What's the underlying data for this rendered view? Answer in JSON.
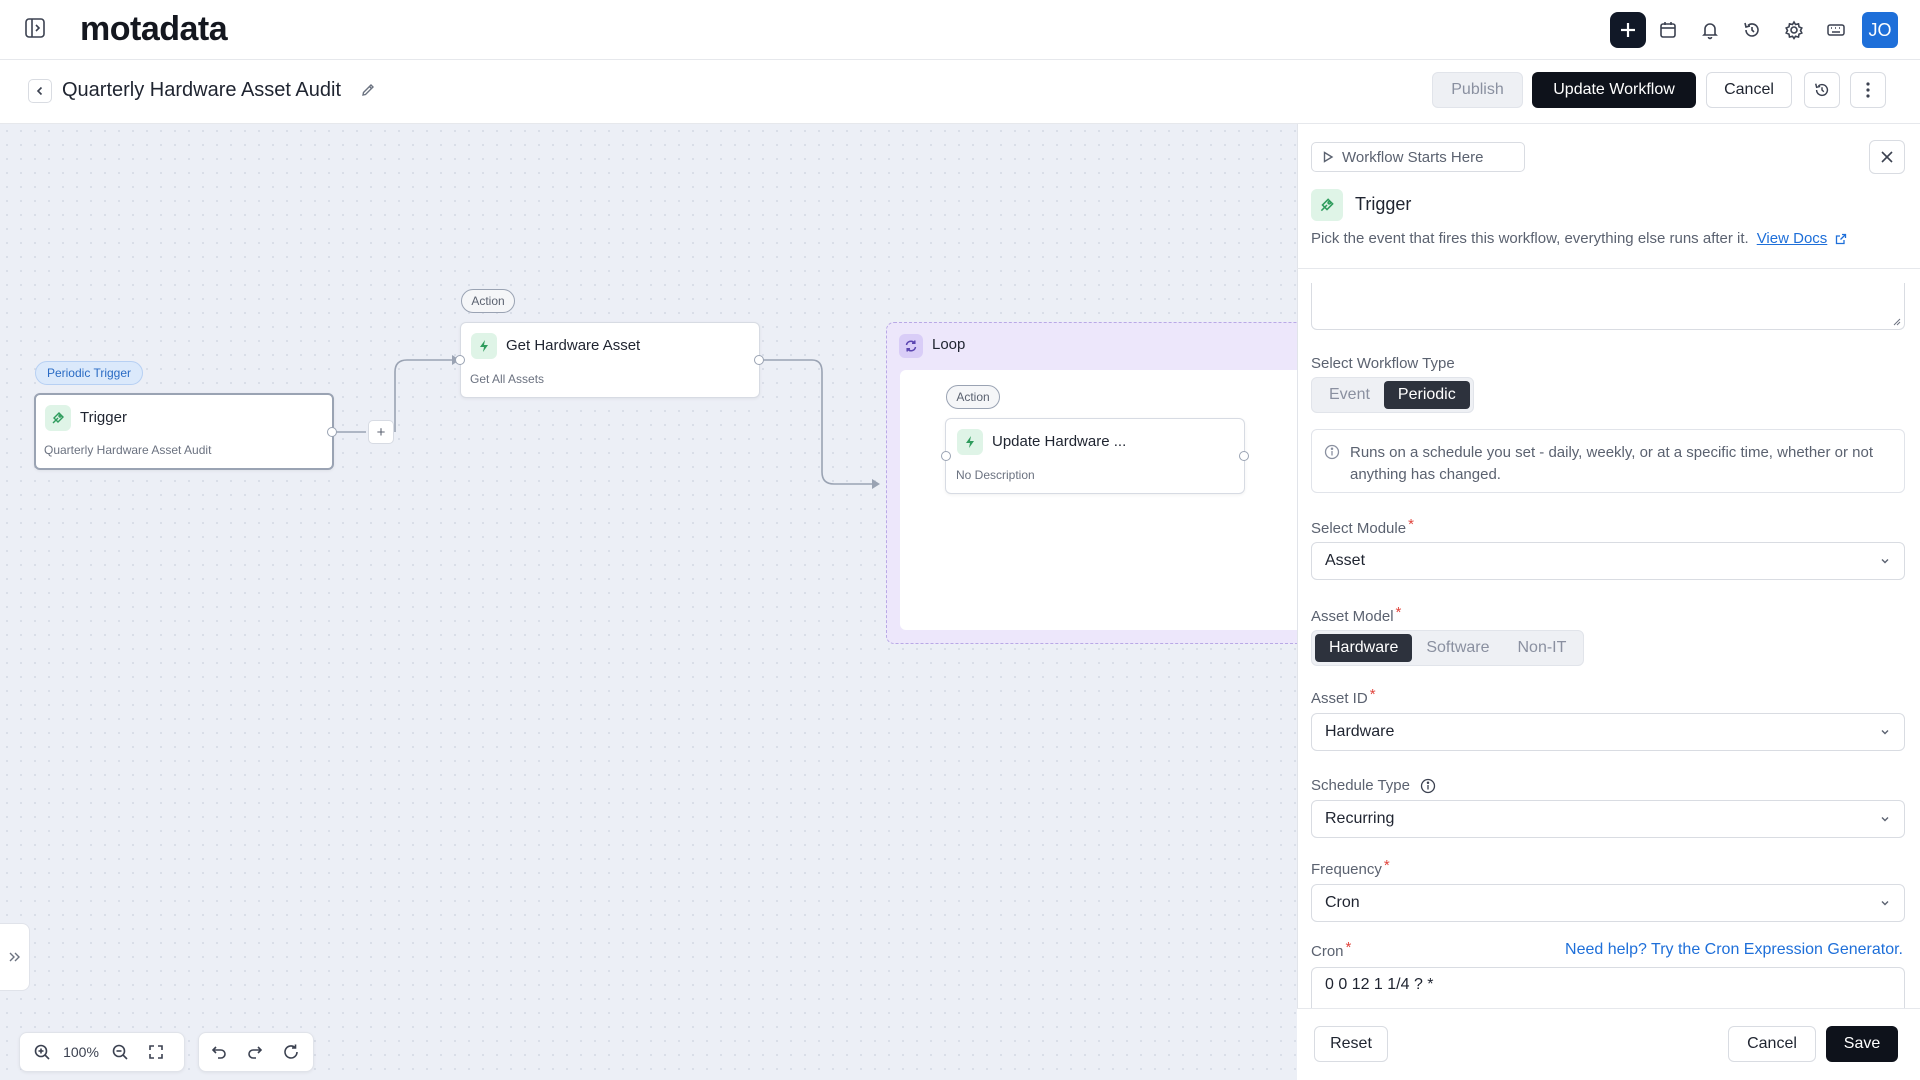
{
  "app": {
    "logo": "motadata"
  },
  "topbar": {
    "avatar_initials": "JO"
  },
  "header": {
    "title": "Quarterly Hardware Asset Audit",
    "publish_label": "Publish",
    "update_label": "Update Workflow",
    "cancel_label": "Cancel"
  },
  "canvas": {
    "trigger_node": {
      "tag": "Periodic Trigger",
      "title": "Trigger",
      "subtitle": "Quarterly Hardware Asset Audit"
    },
    "action_node_1": {
      "tag": "Action",
      "title": "Get Hardware Asset",
      "subtitle": "Get All Assets"
    },
    "loop": {
      "title": "Loop"
    },
    "action_node_2": {
      "tag": "Action",
      "title": "Update Hardware ...",
      "subtitle": "No Description"
    },
    "add_symbol": "+",
    "zoom_level": "100%"
  },
  "panel": {
    "starts_here_label": "Workflow Starts Here",
    "title": "Trigger",
    "description": "Pick the event that fires this workflow, everything else runs after it.",
    "docs_link": "View Docs",
    "workflow_type": {
      "label": "Select Workflow Type",
      "options": [
        "Event",
        "Periodic"
      ],
      "selected": "Periodic"
    },
    "info_text": "Runs on a schedule you set - daily, weekly, or at a specific time, whether or not anything has changed.",
    "module": {
      "label": "Select Module",
      "value": "Asset"
    },
    "asset_model": {
      "label": "Asset Model",
      "options": [
        "Hardware",
        "Software",
        "Non-IT"
      ],
      "selected": "Hardware"
    },
    "asset_id": {
      "label": "Asset ID",
      "value": "Hardware"
    },
    "schedule_type": {
      "label": "Schedule Type",
      "value": "Recurring"
    },
    "frequency": {
      "label": "Frequency",
      "value": "Cron"
    },
    "cron": {
      "label": "Cron",
      "help_link": "Need help? Try the Cron Expression Generator.",
      "value": "0 0 12 1 1/4 ? *"
    },
    "required_mark": "*",
    "footer": {
      "reset_label": "Reset",
      "cancel_label": "Cancel",
      "save_label": "Save"
    }
  },
  "colors": {
    "accent": "#1e6fd9",
    "dark_button": "#0e121b",
    "canvas_bg": "#eceff6",
    "loop_bg": "#ede7fb"
  }
}
